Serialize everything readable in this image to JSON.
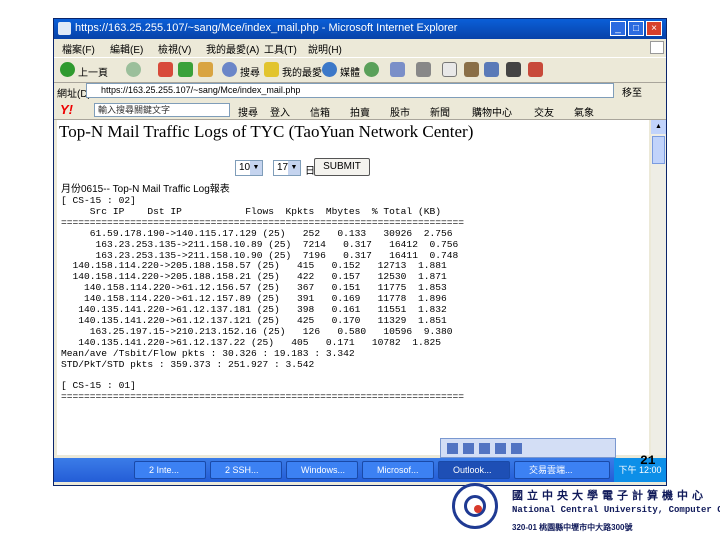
{
  "window": {
    "title": "https://163.25.255.107/~sang/Mce/index_mail.php - Microsoft Internet Explorer",
    "buttons": {
      "minimize": "_",
      "maximize": "□",
      "close": "×"
    }
  },
  "menu": [
    "檔案(F)",
    "編輯(E)",
    "檢視(V)",
    "我的最愛(A)",
    "工具(T)",
    "說明(H)"
  ],
  "toolbar": {
    "back": "上一頁",
    "search": "搜尋",
    "favorites": "我的最愛",
    "media": "媒體"
  },
  "address": {
    "label": "網址(D)",
    "value": "https://163.25.255.107/~sang/Mce/index_mail.php",
    "go": "移至"
  },
  "yahoo": {
    "logo": "Y!",
    "search_placeholder": "輸入搜尋關鍵文字",
    "items": [
      "搜尋",
      "登入",
      "信箱",
      "拍賣",
      "股市",
      "新聞",
      "購物中心",
      "交友",
      "氣象"
    ]
  },
  "page": {
    "title": "Top-N Mail Traffic Logs of TYC (TaoYuan Network Center)",
    "select_n": "10",
    "select_day": "17",
    "day_suffix": "日",
    "submit": "SUBMIT",
    "subtitle": "月份0615-- Top-N Mail Traffic Log報表",
    "log_text": "[ CS-15 : 02]\n     Src IP    Dst IP           Flows  Kpkts  Mbytes  % Total (KB)\n======================================================================\n     61.59.178.190->140.115.17.129 (25)   252   0.133   30926  2.756\n      163.23.253.135->211.158.10.89 (25)  7214   0.317   16412  0.756\n      163.23.253.135->211.158.10.90 (25)  7196   0.317   16411  0.748\n  140.158.114.220->205.188.158.57 (25)   415   0.152   12713  1.881\n  140.158.114.220->205.188.158.21 (25)   422   0.157   12530  1.871\n    140.158.114.220->61.12.156.57 (25)   367   0.151   11775  1.853\n    140.158.114.220->61.12.157.89 (25)   391   0.169   11778  1.896\n   140.135.141.220->61.12.137.181 (25)   398   0.161   11551  1.832\n   140.135.141.220->61.12.137.121 (25)   425   0.170   11329  1.851\n     163.25.197.15->210.213.152.16 (25)   126   0.580   10596  9.380\n   140.135.141.220->61.12.137.22 (25)   405   0.171   10782  1.825\nMean/ave /Tsbit/Flow pkts : 30.326 : 19.183 : 3.342\nSTD/PkT/STD pkts : 359.373 : 251.927 : 3.542\n\n[ CS-15 : 01]\n======================================================================"
  },
  "scrollbar": {
    "up": "▲"
  },
  "taskbar": {
    "items": [
      "2 Inte...",
      "2 SSH...",
      "Windows...",
      "Microsof...",
      "Outlook...",
      "交易雲端..."
    ],
    "tray": "下午 12:00"
  },
  "slide_number": "21",
  "footer": {
    "name_zh": "國立中央大學電子計算機中心",
    "name_en": "National Central University, Computer Center",
    "address": "320-01 桃園縣中壢市中大路300號"
  },
  "colors": {
    "titlebar": "#0a5fd8",
    "taskbar": "#245dd6",
    "logo": "#1f3a93"
  }
}
